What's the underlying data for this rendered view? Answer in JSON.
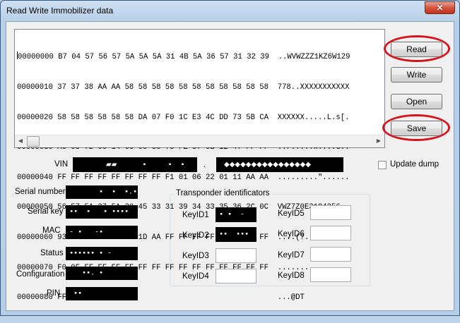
{
  "window": {
    "title": "Read Write Immobilizer data",
    "close_glyph": "✕"
  },
  "hex_dump": {
    "lines": [
      "00000000 B7 04 57 56 57 5A 5A 5A 31 4B 5A 36 57 31 32 39  ..WVWZZZ1KZ6W129",
      "00000010 37 37 38 AA AA 58 58 58 58 58 58 58 58 58 58 58  778..XXXXXXXXXXX",
      "00000020 58 58 58 58 58 58 DA 07 F0 1C E3 4C DD 73 5B CA  XXXXXX.....L.s[.",
      "00000030 A6 08 72 00 14 00 00 80 78 FE 87 0B 1E 47 FF FF  ..r.....x....G..",
      "00000040 FF FF FF FF FF FF FF FF F1 01 06 22 01 11 AA AA  .........\"......",
      "00000050 56 57 5A 37 5A 30 45 33 31 39 34 33 35 36 2C 0C  VWZ7Z0E3194356,.",
      "00000060 93 FB 91 E7 28 3F 1D AA FF FF FF FF FF FF FF FF  ....(?..........",
      "00000070 F0 0F FF FF FF FF FF FF FF FF FF FF FF FF FF FF  ................",
      "00000080 FF FF 04 40 44 54                                ...@DT"
    ],
    "scroll_left": "◀",
    "scroll_right": "▶"
  },
  "buttons": {
    "read": "Read",
    "write": "Write",
    "open": "Open",
    "save": "Save"
  },
  "vin": {
    "label": "VIN",
    "separator": "."
  },
  "update_dump": {
    "label": "Update dump",
    "checked": false
  },
  "fields": {
    "serial_number": "Serial number",
    "serial_key": "Serial key",
    "mac": "MAC",
    "status": "Status",
    "configuration": "Configuration",
    "pin": "PIN"
  },
  "transponder": {
    "title": "Transponder identificators",
    "key_labels": [
      "KeyID1",
      "KeyID2",
      "KeyID3",
      "KeyID4",
      "KeyID5",
      "KeyID6",
      "KeyID7",
      "KeyID8"
    ]
  },
  "colors": {
    "highlight": "#d4141e",
    "redaction": "#000000"
  }
}
